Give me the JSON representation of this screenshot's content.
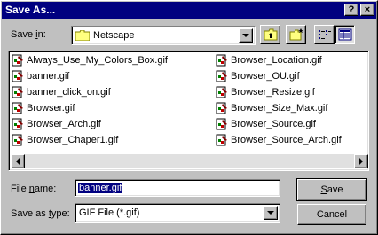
{
  "window": {
    "title": "Save As...",
    "help_btn": "?",
    "close_btn": "×"
  },
  "save_in": {
    "label_pre": "Save ",
    "label_ul": "i",
    "label_post": "n:",
    "value": "Netscape"
  },
  "files": {
    "col1": [
      "Always_Use_My_Colors_Box.gif",
      "banner.gif",
      "banner_click_on.gif",
      "Browser.gif",
      "Browser_Arch.gif",
      "Browser_Chaper1.gif"
    ],
    "col2": [
      "Browser_Location.gif",
      "Browser_OU.gif",
      "Browser_Resize.gif",
      "Browser_Size_Max.gif",
      "Browser_Source.gif",
      "Browser_Source_Arch.gif"
    ]
  },
  "filename": {
    "label_pre": "File ",
    "label_ul": "n",
    "label_post": "ame:",
    "value": "banner.gif"
  },
  "filetype": {
    "label_pre": "Save as ",
    "label_ul": "t",
    "label_post": "ype:",
    "value": "GIF File (*.gif)"
  },
  "buttons": {
    "save_ul": "S",
    "save_rest": "ave",
    "cancel": "Cancel"
  },
  "colors": {
    "title_bg": "#000080",
    "face": "#c0c0c0",
    "selection": "#000080"
  }
}
